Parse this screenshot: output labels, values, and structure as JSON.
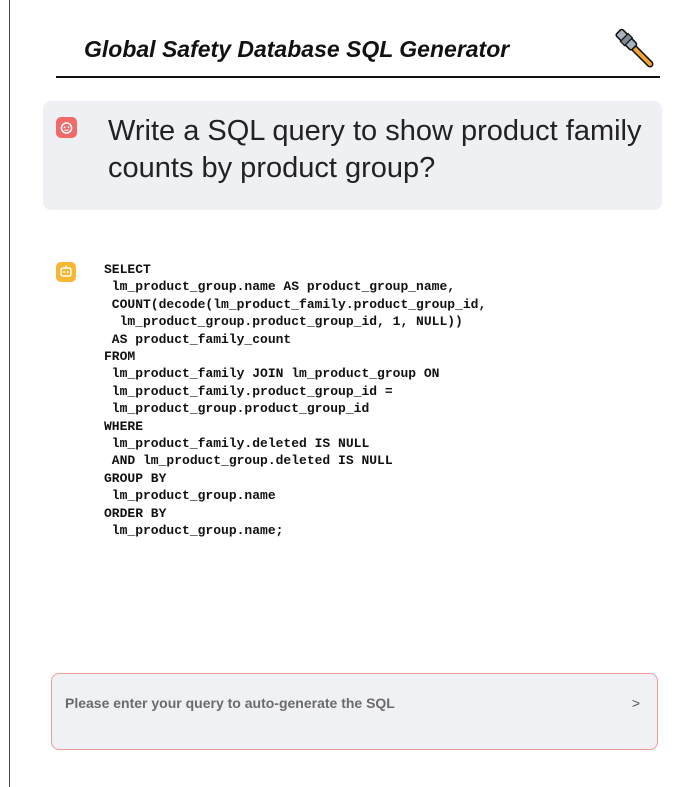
{
  "header": {
    "title": "Global Safety Database SQL Generator",
    "icon": "hammer-icon"
  },
  "conversation": {
    "user_message": {
      "avatar_icon": "user-avatar-icon",
      "avatar_color": "#f06a6a",
      "text": "Write a SQL query to show product family counts by product group?"
    },
    "bot_message": {
      "avatar_icon": "bot-avatar-icon",
      "avatar_color": "#f7b733",
      "sql": "SELECT\n lm_product_group.name AS product_group_name,\n COUNT(decode(lm_product_family.product_group_id,\n  lm_product_group.product_group_id, 1, NULL))\n AS product_family_count\nFROM\n lm_product_family JOIN lm_product_group ON\n lm_product_family.product_group_id =\n lm_product_group.product_group_id\nWHERE\n lm_product_family.deleted IS NULL\n AND lm_product_group.deleted IS NULL\nGROUP BY\n lm_product_group.name\nORDER BY\n lm_product_group.name;"
    }
  },
  "input": {
    "placeholder": "Please enter your query to auto-generate the SQL",
    "value": "",
    "send_label": ">",
    "border_color": "#f09a9a"
  }
}
